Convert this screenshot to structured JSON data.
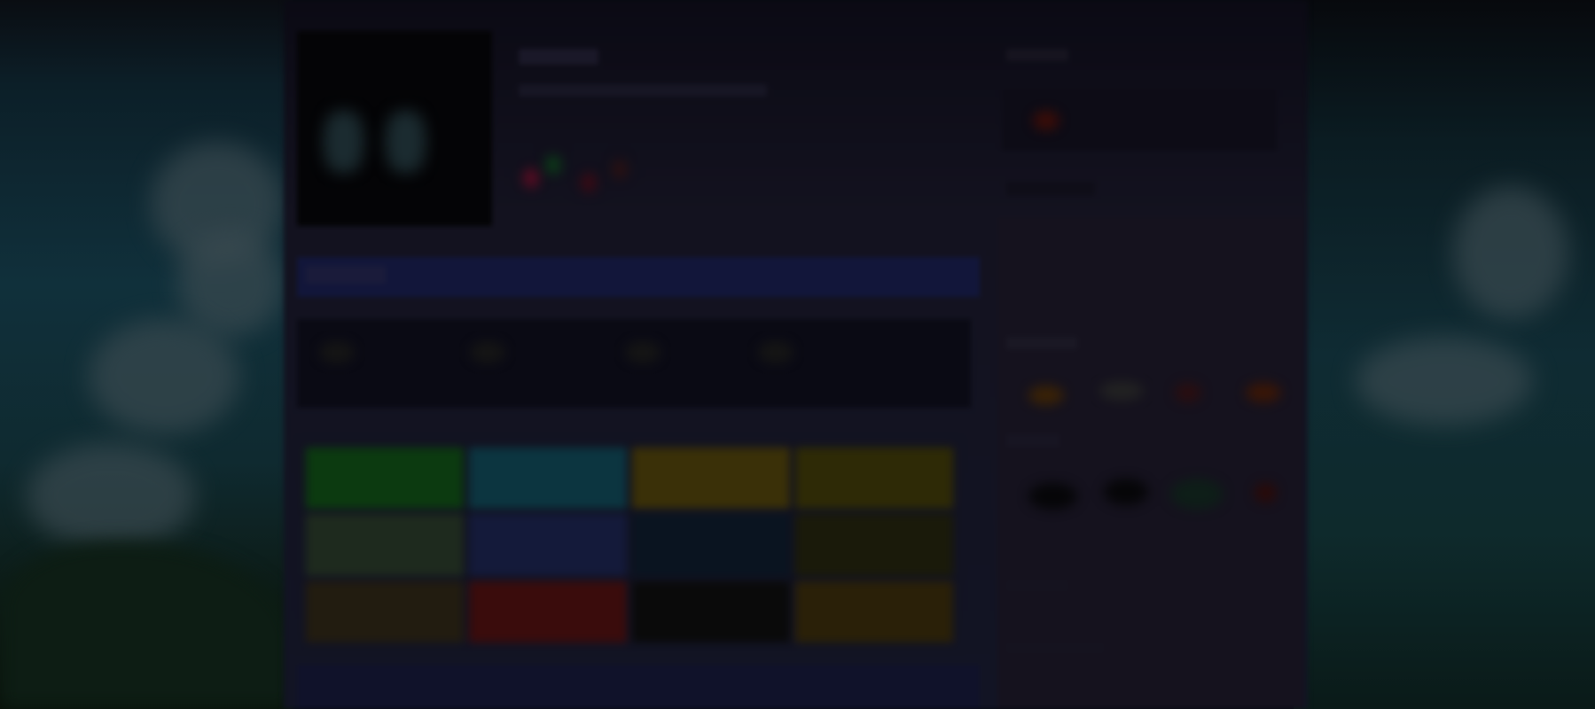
{
  "theme": {
    "page_background": "#13121f",
    "showcase_accent": "#12163a",
    "sidebar_background": "#16131f"
  },
  "showcase": {
    "tiles": [
      {
        "color": "#0c3a10"
      },
      {
        "color": "#0c3540"
      },
      {
        "color": "#3a3008"
      },
      {
        "color": "#2e2a06"
      },
      {
        "color": "#1e2a1e"
      },
      {
        "color": "#141a3a"
      },
      {
        "color": "#0a1420"
      },
      {
        "color": "#1a1a0a"
      },
      {
        "color": "#221c10"
      },
      {
        "color": "#3a0c0c"
      },
      {
        "color": "#0a0a0a"
      },
      {
        "color": "#2a2008"
      }
    ]
  }
}
